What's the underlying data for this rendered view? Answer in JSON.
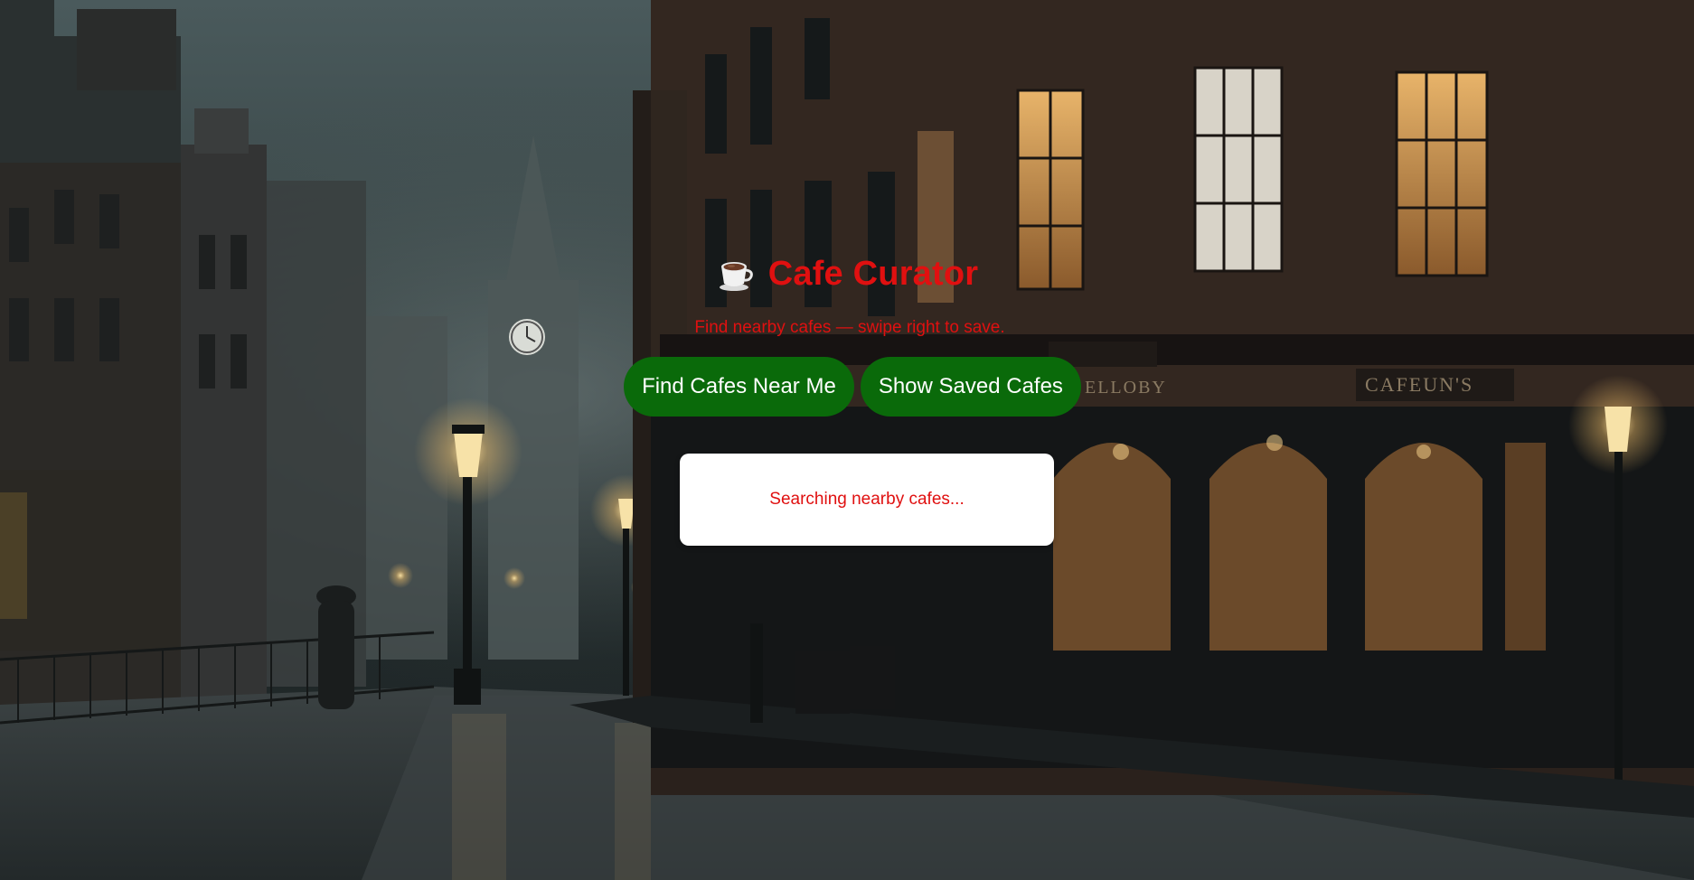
{
  "app": {
    "title": "Cafe Curator",
    "icon": "coffee-cup-icon",
    "subtitle": "Find nearby cafes — swipe right to save."
  },
  "actions": {
    "find_label": "Find Cafes Near Me",
    "saved_label": "Show Saved Cafes"
  },
  "status": {
    "message": "Searching nearby cafes..."
  },
  "background": {
    "description_icon": "foggy-street-scene",
    "signs": [
      "ELLOBY",
      "CAFEUN'S"
    ]
  },
  "colors": {
    "title": "#e01010",
    "button_bg": "#0a6a0a",
    "button_text": "#ffffff",
    "card_bg": "#ffffff"
  }
}
